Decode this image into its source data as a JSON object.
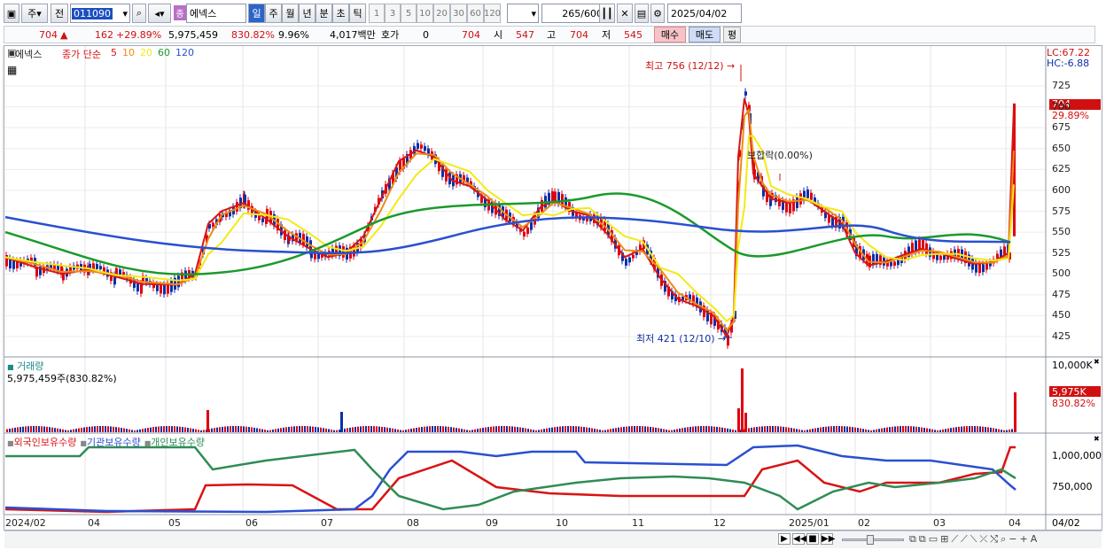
{
  "toolbar": {
    "type": "주",
    "prev": "전",
    "code": "011090",
    "stock_type_badge": "종",
    "name": "에넥스",
    "periods": [
      "일",
      "주",
      "월",
      "년",
      "분",
      "초",
      "틱"
    ],
    "period_selected": "일",
    "intervals": [
      "1",
      "3",
      "5",
      "10",
      "20",
      "30",
      "60",
      "120"
    ],
    "count": "265",
    "count_total": "/600",
    "date": "2025/04/02"
  },
  "info": {
    "price": "704",
    "change": "162",
    "change_pct": "+29.89%",
    "volume": "5,975,459",
    "vol_ratio": "830.82%",
    "turnover": "9.96%",
    "amount": "4,017백만",
    "quote_label": "호가",
    "quote_val": "0",
    "quote_price": "704",
    "open_label": "시",
    "open": "547",
    "high_label": "고",
    "high": "704",
    "low_label": "저",
    "low": "545",
    "buy": "매수",
    "sell": "매도",
    "eval": "평"
  },
  "price_panel": {
    "stock": "에넥스",
    "ma_label": "종가 단순",
    "ma_periods": [
      "5",
      "10",
      "20",
      "60",
      "120"
    ],
    "lc": "LC:67.22",
    "hc": "HC:-6.88",
    "price_tag": "704",
    "pct_tag": "29.89%",
    "max_label": "최고 756 (12/12)",
    "min_label": "최저 421 (12/10)",
    "annotation": "보합락(0.00%)",
    "y_ticks": [
      "725",
      "700",
      "675",
      "650",
      "625",
      "600",
      "575",
      "550",
      "525",
      "500",
      "475",
      "450",
      "425"
    ]
  },
  "volume_panel": {
    "title": "거래량",
    "value_line": "5,975,459주(830.82%)",
    "y_tick": "10,000K",
    "tag": "5,975K",
    "tag_pct": "830.82%"
  },
  "holdings_panel": {
    "legend": [
      "외국인보유수량",
      "기관보유수량",
      "개인보유수량"
    ],
    "y_ticks": [
      "1,000,000",
      "750,000"
    ]
  },
  "x_axis": {
    "labels": [
      "2024/02",
      "04",
      "05",
      "06",
      "07",
      "08",
      "09",
      "10",
      "11",
      "12",
      "2025/01",
      "02",
      "03",
      "04"
    ],
    "current": "04/02"
  },
  "colors": {
    "up": "#e0000f",
    "down": "#0c2fa8",
    "ma5": "#d81414",
    "ma10": "#f08a12",
    "ma20": "#f2ea14",
    "ma60": "#1a9a2a",
    "ma120": "#2a4fd0",
    "foreign": "#d81414",
    "inst": "#2a4fd0",
    "indiv": "#2f8c55"
  }
}
